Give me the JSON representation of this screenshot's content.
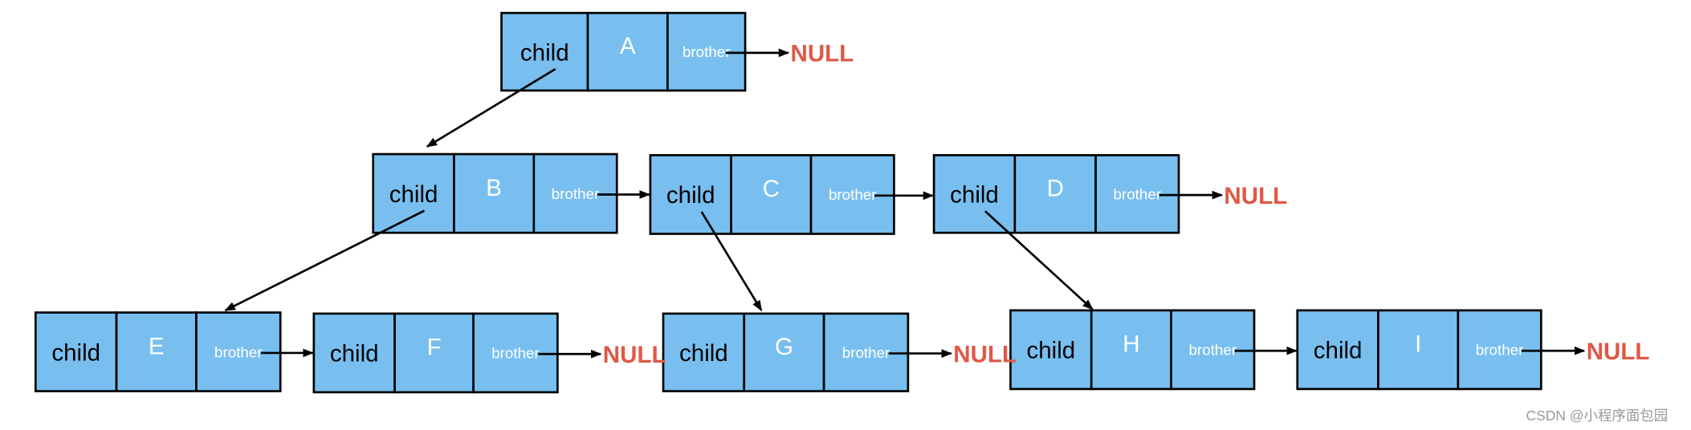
{
  "diagram": {
    "field_labels": {
      "child": "child",
      "brother": "brother"
    },
    "null_label": "NULL",
    "colors": {
      "node_fill": "#78bff0",
      "null_text": "#df5846",
      "border": "#000000"
    },
    "nodes": [
      {
        "id": "A",
        "label": "A"
      },
      {
        "id": "B",
        "label": "B"
      },
      {
        "id": "C",
        "label": "C"
      },
      {
        "id": "D",
        "label": "D"
      },
      {
        "id": "E",
        "label": "E"
      },
      {
        "id": "F",
        "label": "F"
      },
      {
        "id": "G",
        "label": "G"
      },
      {
        "id": "H",
        "label": "H"
      },
      {
        "id": "I",
        "label": "I"
      }
    ],
    "child_links": [
      [
        "A",
        "B"
      ],
      [
        "B",
        "E"
      ],
      [
        "C",
        "G"
      ],
      [
        "D",
        "H"
      ]
    ],
    "brother_links": [
      [
        "A",
        null
      ],
      [
        "B",
        "C"
      ],
      [
        "C",
        "D"
      ],
      [
        "D",
        null
      ],
      [
        "E",
        "F"
      ],
      [
        "F",
        null
      ],
      [
        "G",
        null
      ],
      [
        "H",
        "I"
      ],
      [
        "I",
        null
      ]
    ]
  },
  "watermark": "CSDN @小程序面包园"
}
